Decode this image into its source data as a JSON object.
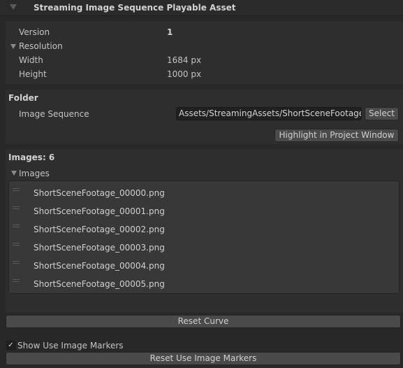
{
  "header": {
    "title": "Streaming Image Sequence Playable Asset"
  },
  "properties": {
    "version_label": "Version",
    "version_value": "1",
    "resolution_label": "Resolution",
    "width_label": "Width",
    "width_value": "1684 px",
    "height_label": "Height",
    "height_value": "1000 px"
  },
  "folder": {
    "section_label": "Folder",
    "image_sequence_label": "Image Sequence",
    "image_sequence_value": "Assets/StreamingAssets/ShortSceneFootage",
    "select_label": "Select",
    "highlight_label": "Highlight in Project Window"
  },
  "images": {
    "count_label": "Images: 6",
    "foldout_label": "Images",
    "items": [
      "ShortSceneFootage_00000.png",
      "ShortSceneFootage_00001.png",
      "ShortSceneFootage_00002.png",
      "ShortSceneFootage_00003.png",
      "ShortSceneFootage_00004.png",
      "ShortSceneFootage_00005.png"
    ]
  },
  "actions": {
    "reset_curve_label": "Reset Curve",
    "show_markers_label": "Show Use Image Markers",
    "show_markers_checked": true,
    "reset_markers_label": "Reset Use Image Markers"
  }
}
